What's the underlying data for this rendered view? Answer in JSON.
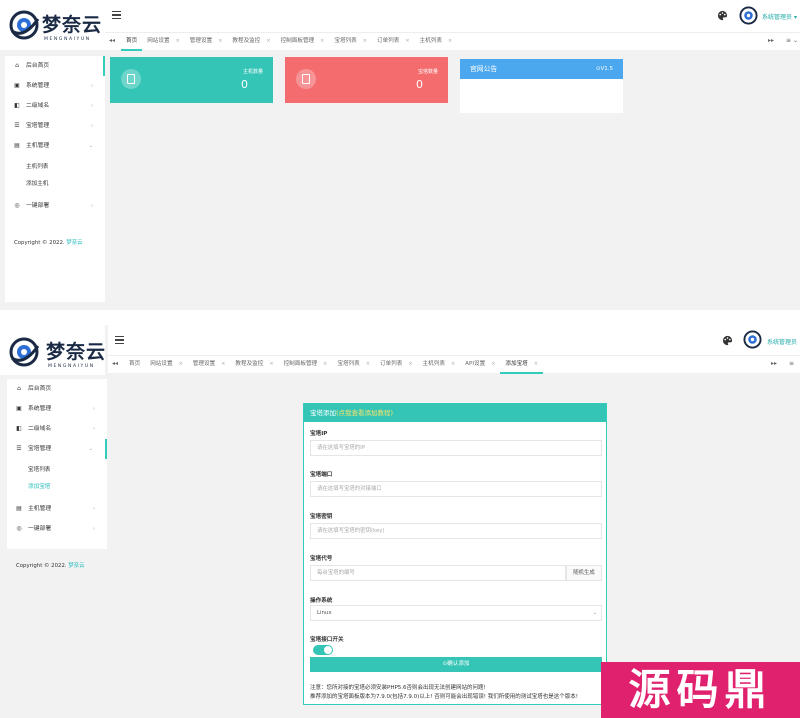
{
  "brand": {
    "name": "梦奈云",
    "sub": "MENGNAIYUN"
  },
  "header": {
    "user_name": "系统管理员",
    "caret": "▾"
  },
  "icons": {
    "tab_prev": "◂◂",
    "tab_next": "▸▸",
    "tab_more": "≡",
    "tab_close": "×",
    "chevron": "›",
    "chevron_down": "⌄"
  },
  "colors": {
    "teal": "#35c5b6",
    "red": "#f46c6e",
    "blue": "#4ba8ef",
    "watermark": "#e0226e"
  },
  "screen1": {
    "tabs": [
      "首页",
      "网站设置",
      "管理设置",
      "教程及监控",
      "控制面板管理",
      "宝塔列表",
      "订单列表",
      "主机列表"
    ],
    "active_tab": 0,
    "sidebar": [
      {
        "label": "后台首页",
        "icon": "home-icon",
        "glyph": "⌂"
      },
      {
        "label": "系统管理",
        "icon": "monitor-icon",
        "glyph": "▣"
      },
      {
        "label": "二级域名",
        "icon": "domain-icon",
        "glyph": "◧"
      },
      {
        "label": "宝塔管理",
        "icon": "server-icon",
        "glyph": "☰"
      },
      {
        "label": "主机管理",
        "icon": "host-icon",
        "glyph": "▤"
      },
      {
        "label": "一键部署",
        "icon": "deploy-icon",
        "glyph": "◎"
      }
    ],
    "submenu": [
      "主机列表",
      "添加主机"
    ],
    "copyright_prefix": "Copyright © 2022.",
    "copyright_brand": "梦奈云",
    "cards": [
      {
        "title": "主机数量",
        "value": "0"
      },
      {
        "title": "宝塔数量",
        "value": "0"
      }
    ],
    "notice": {
      "title": "官网公告",
      "version": "V1.5"
    }
  },
  "screen2": {
    "tabs": [
      "首页",
      "网站设置",
      "管理设置",
      "教程及监控",
      "控制面板管理",
      "宝塔列表",
      "订单列表",
      "主机列表",
      "API设置",
      "添加宝塔"
    ],
    "active_tab": 9,
    "sidebar": [
      {
        "label": "后台首页",
        "icon": "home-icon",
        "glyph": "⌂"
      },
      {
        "label": "系统管理",
        "icon": "monitor-icon",
        "glyph": "▣"
      },
      {
        "label": "二级域名",
        "icon": "domain-icon",
        "glyph": "◧"
      },
      {
        "label": "宝塔管理",
        "icon": "server-icon",
        "glyph": "☰"
      },
      {
        "label": "主机管理",
        "icon": "host-icon",
        "glyph": "▤"
      },
      {
        "label": "一键部署",
        "icon": "deploy-icon",
        "glyph": "◎"
      }
    ],
    "submenu": [
      "宝塔列表",
      "添加宝塔"
    ],
    "copyright_prefix": "Copyright © 2022.",
    "copyright_brand": "梦奈云",
    "form": {
      "title": "宝塔添加",
      "title_link": "(点我查看添加教程)",
      "ip_label": "宝塔IP",
      "ip_placeholder": "请在这填写宝塔的IP",
      "port_label": "宝塔端口",
      "port_placeholder": "请在这填写宝塔的对接端口",
      "key_label": "宝塔密钥",
      "key_placeholder": "请在这填写宝塔的密钥(key)",
      "code_label": "宝塔代号",
      "code_placeholder": "每台宝塔的编号",
      "random_button": "随机生成",
      "os_label": "操作系统",
      "os_value": "Linux",
      "switch_label": "宝塔接口开关",
      "switch_on": true,
      "submit": "⊙确认添加",
      "note1": "注意：您所对接的宝塔必须安装PHP5.6否则会出现无法创建网站的问题!",
      "note2": "推荐添加的宝塔面板版本为7.9.0(包括7.9.0)以上! 否则可能会出现错误! 我们所使用的测试宝塔也是这个版本!"
    }
  },
  "watermark": "源码鼎"
}
